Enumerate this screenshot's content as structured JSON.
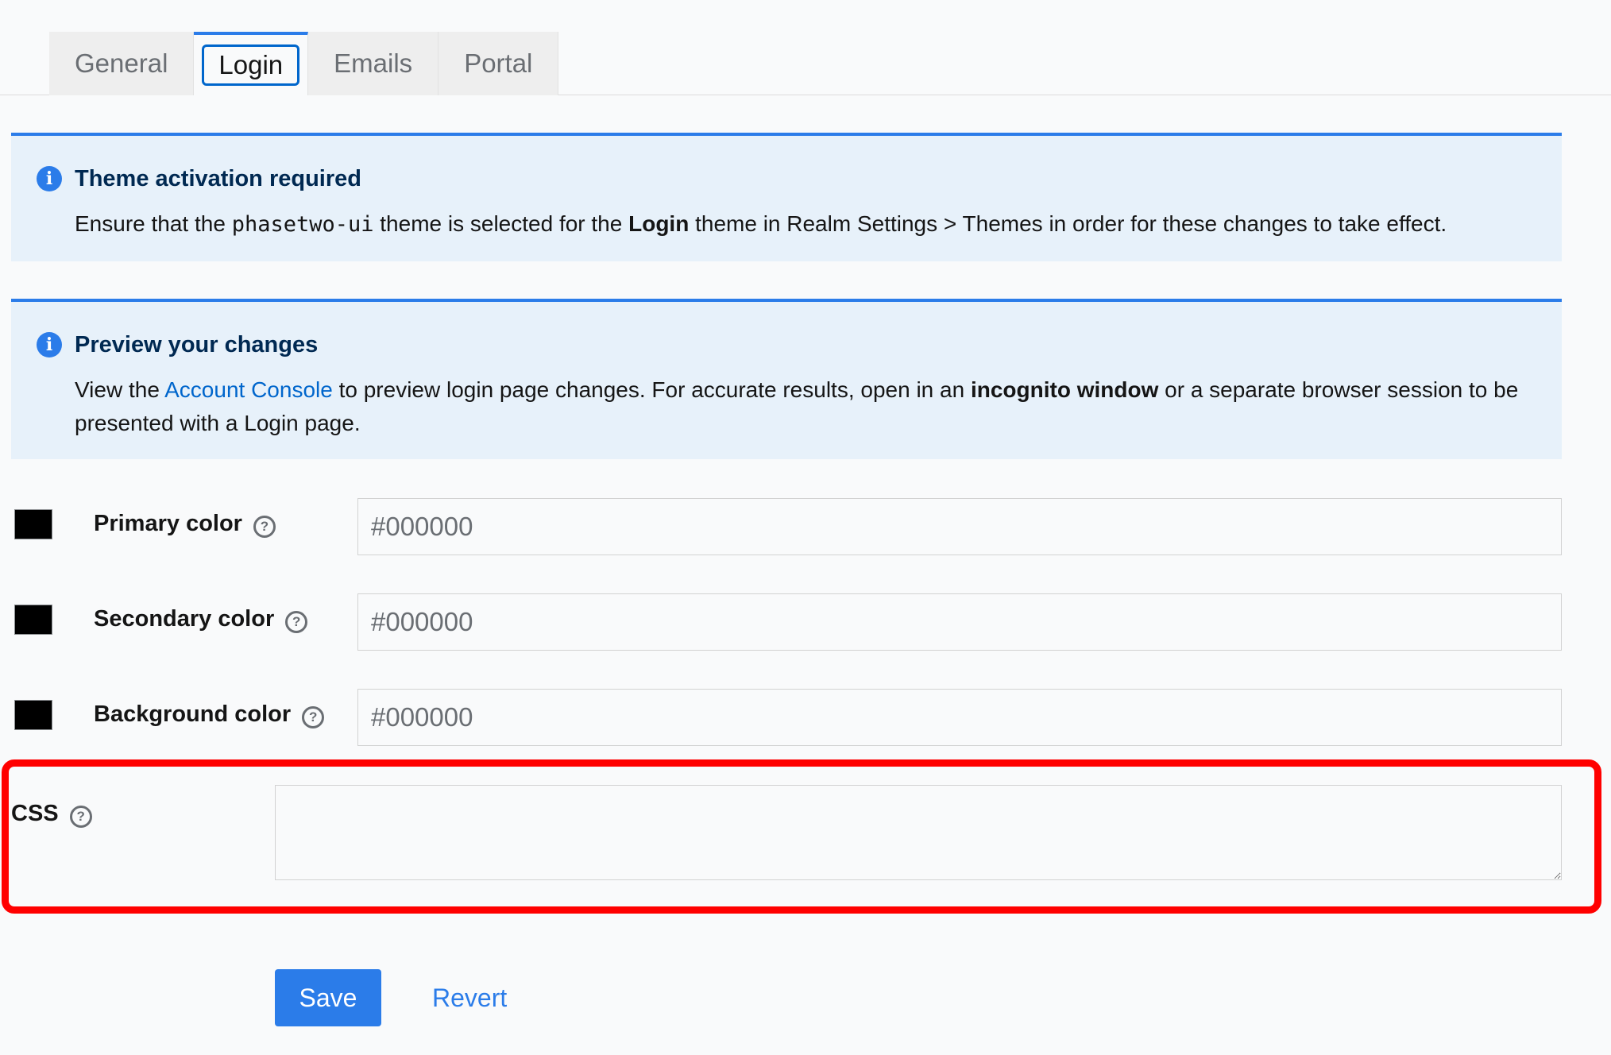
{
  "tabs": [
    {
      "label": "General",
      "active": false
    },
    {
      "label": "Login",
      "active": true
    },
    {
      "label": "Emails",
      "active": false
    },
    {
      "label": "Portal",
      "active": false
    }
  ],
  "alerts": {
    "theme": {
      "title": "Theme activation required",
      "text_1": "Ensure that the ",
      "code": "phasetwo-ui",
      "text_2": " theme is selected for the ",
      "bold": "Login",
      "text_3": " theme in Realm Settings > Themes in order for these changes to take effect."
    },
    "preview": {
      "title": "Preview your changes",
      "text_1": "View the ",
      "link": "Account Console",
      "text_2": " to preview login page changes. For accurate results, open in an ",
      "bold": "incognito window",
      "text_3": " or a separate browser session to be presented with a Login page."
    }
  },
  "fields": {
    "primary": {
      "label": "Primary color",
      "value": "#000000",
      "swatch": "#000000"
    },
    "secondary": {
      "label": "Secondary color",
      "value": "#000000",
      "swatch": "#000000"
    },
    "background": {
      "label": "Background color",
      "value": "#000000",
      "swatch": "#000000"
    },
    "css": {
      "label": "CSS",
      "value": ""
    }
  },
  "actions": {
    "save_label": "Save",
    "revert_label": "Revert"
  },
  "colors": {
    "accent": "#2b7ce9",
    "alert_bg": "#e7f1fa",
    "highlight": "#ff0000"
  }
}
